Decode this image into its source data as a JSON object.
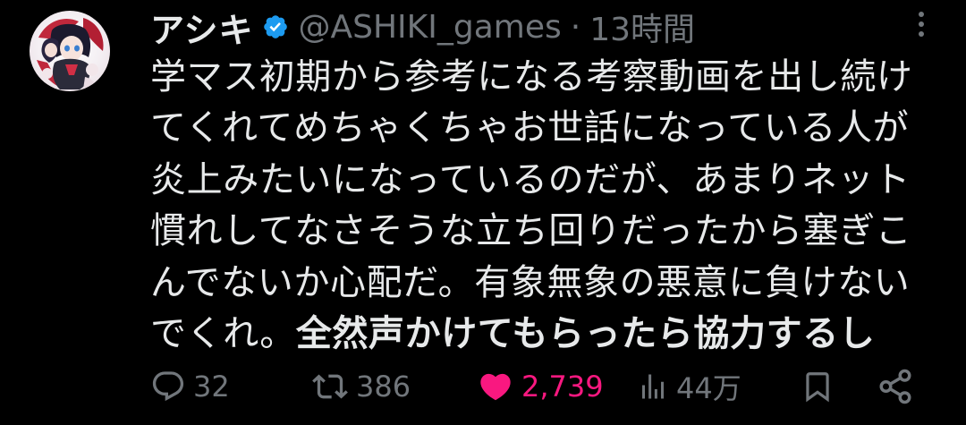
{
  "colors": {
    "background": "#000000",
    "text": "#e7e9ea",
    "muted": "#71767b",
    "like": "#f91880",
    "verified": "#1d9bf0"
  },
  "author": {
    "display_name": "アシキ",
    "handle": "@ASHIKI_games",
    "separator": "·",
    "timestamp": "13時間",
    "verified_icon": "verified-badge-icon"
  },
  "tweet": {
    "lines": [
      "学マス初期から参考になる考察動画を出し続け",
      "てくれてめちゃくちゃお世話になっている人が",
      "炎上みたいになっているのだが、あまりネット",
      "慣れしてなさそうな立ち回りだったから塞ぎこ",
      "んでないか心配だ。有象無象の悪意に負けない"
    ],
    "last_line_normal": "でくれ。",
    "last_line_bold": "全然声かけてもらったら協力するし"
  },
  "actions": {
    "reply_count": "32",
    "retweet_count": "386",
    "like_count": "2,739",
    "views_count": "44万"
  }
}
